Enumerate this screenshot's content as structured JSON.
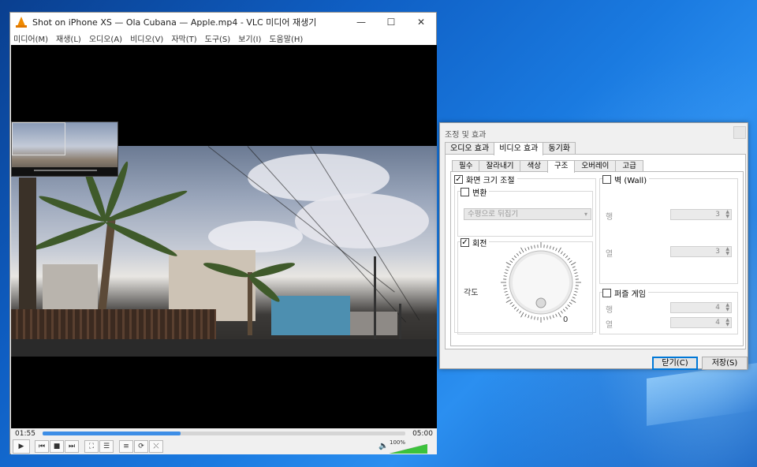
{
  "vlc": {
    "title": "Shot on iPhone XS — Ola Cubana — Apple.mp4 - VLC 미디어 재생기",
    "menu": [
      "미디어(M)",
      "재생(L)",
      "오디오(A)",
      "비디오(V)",
      "자막(T)",
      "도구(S)",
      "보기(I)",
      "도움말(H)"
    ],
    "time_elapsed": "01:55",
    "time_total": "05:00",
    "progress": 0.38,
    "volume_label": "100%",
    "volume": 1.0
  },
  "dialog": {
    "title": "조정 및 효과",
    "tabs": [
      "오디오 효과",
      "비디오 효과",
      "동기화"
    ],
    "subtabs": [
      "필수",
      "잘라내기",
      "색상",
      "구조",
      "오버레이",
      "고급"
    ],
    "scale_label": "화면 크기 조절",
    "transform_label": "변환",
    "transform_value": "수평으로 뒤집기",
    "rotate_label": "회전",
    "angle_label": "각도",
    "angle_value": "0",
    "wall_label": "벽 (Wall)",
    "rows_label": "행",
    "cols_label": "열",
    "wall_rows": "3",
    "wall_cols": "3",
    "puzzle_label": "퍼즐 게임",
    "puzzle_rows": "4",
    "puzzle_cols": "4",
    "close_button": "닫기(C)",
    "save_button": "저장(S)"
  },
  "colors": {
    "accent": "#0078d7",
    "seek": "#3d8ee6",
    "vlc_orange": "#f08a00"
  }
}
